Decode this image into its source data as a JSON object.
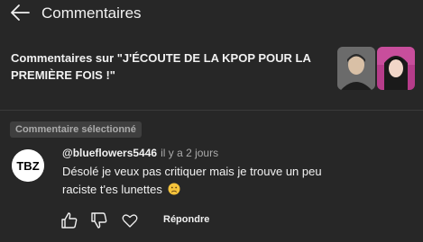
{
  "header": {
    "title": "Commentaires",
    "back_icon": "arrow-left-icon"
  },
  "context": {
    "text": "Commentaires sur \"J'ÉCOUTE DE LA KPOP POUR LA PREMIÈRE FOIS !\""
  },
  "selected": {
    "label": "Commentaire sélectionné"
  },
  "comment": {
    "author": "@blueflowers5446",
    "time": "il y a 2 jours",
    "text": "Désolé je veux pas critiquer mais je trouve un peu raciste t'es lunettes",
    "avatar_text": "TBZ"
  },
  "actions": {
    "reply_label": "Répondre"
  },
  "colors": {
    "background": "#272727",
    "text": "#f1f1f1",
    "secondary": "#aaaaaa",
    "badge_bg": "#3f3f3f"
  }
}
